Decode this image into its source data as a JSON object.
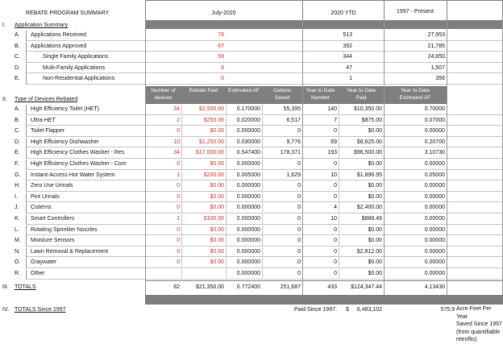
{
  "sheet": {
    "title": "REBATE PROGRAM SUMMARY",
    "col_headers": {
      "july": "July-2020",
      "ytd": "2020 YTD",
      "present": "1997 - Present"
    },
    "section1": {
      "num": "I.",
      "label": "Application Summary",
      "rows": [
        {
          "letter": "A.",
          "label": "Applications Received",
          "july": "78",
          "ytd": "513",
          "present": "27,953",
          "indent": false
        },
        {
          "letter": "B.",
          "label": "Applications Approved",
          "july": "67",
          "ytd": "392",
          "present": "21,785",
          "indent": false
        },
        {
          "letter": "C.",
          "label": "Single Family Applications",
          "july": "59",
          "ytd": "344",
          "present": "24,850",
          "indent": true
        },
        {
          "letter": "D.",
          "label": "Multi-Family Applications",
          "july": "8",
          "ytd": "47",
          "present": "1,507",
          "indent": true
        },
        {
          "letter": "E.",
          "label": "Non-Residential Applications",
          "july": "0",
          "ytd": "1",
          "present": "356",
          "indent": true
        }
      ]
    },
    "section2": {
      "num": "II.",
      "label": "Type of Devices Rebated",
      "headers": [
        {
          "line1": "Number of",
          "line2": "devices"
        },
        {
          "line1": "",
          "line2": "Rebate Paid"
        },
        {
          "line1": "",
          "line2": "Estimated AF"
        },
        {
          "line1": "Gallons",
          "line2": "Saved"
        },
        {
          "line1": "Year to Date",
          "line2": "Number"
        },
        {
          "line1": "Year to Date",
          "line2": "Paid"
        },
        {
          "line1": "Year to Date",
          "line2": "Estimated AF"
        }
      ],
      "rows": [
        {
          "letter": "A.",
          "label": "High Efficiency Toilet (HET)",
          "devices": "34",
          "paid": "$2,550.00",
          "af": "0.170000",
          "gallons": "55,395",
          "ytd_num": "140",
          "ytd_paid": "$10,350.00",
          "ytd_af": "0.70000"
        },
        {
          "letter": "B.",
          "label": "Ultra HET",
          "devices": "2",
          "paid": "$250.00",
          "af": "0.020000",
          "gallons": "6,517",
          "ytd_num": "7",
          "ytd_paid": "$875.00",
          "ytd_af": "0.07000"
        },
        {
          "letter": "C.",
          "label": "Toilet Flapper",
          "devices": "0",
          "paid": "$0.00",
          "af": "0.000000",
          "gallons": "0",
          "ytd_num": "0",
          "ytd_paid": "$0.00",
          "ytd_af": "0.00000"
        },
        {
          "letter": "D.",
          "label": "High Efficiency Dishwasher",
          "devices": "10",
          "paid": "$1,250.00",
          "af": "0.030000",
          "gallons": "9,776",
          "ytd_num": "69",
          "ytd_paid": "$8,625.00",
          "ytd_af": "0.20700"
        },
        {
          "letter": "E.",
          "label": "High Efficiency Clothes Washer - Res",
          "devices": "34",
          "paid": "$17,000.00",
          "af": "0.547400",
          "gallons": "178,371",
          "ytd_num": "193",
          "ytd_paid": "$96,500.00",
          "ytd_af": "3.10730"
        },
        {
          "letter": "F.",
          "label": "High Efficiency Clothes Washer - Com",
          "devices": "0",
          "paid": "$0.00",
          "af": "0.000000",
          "gallons": "0",
          "ytd_num": "0",
          "ytd_paid": "$0.00",
          "ytd_af": "0.00000"
        },
        {
          "letter": "G.",
          "label": "Instant-Access Hot Water System",
          "devices": "1",
          "paid": "$200.00",
          "af": "0.005000",
          "gallons": "1,629",
          "ytd_num": "10",
          "ytd_paid": "$1,896.95",
          "ytd_af": "0.05000"
        },
        {
          "letter": "H.",
          "label": "Zero Use Urinals",
          "devices": "0",
          "paid": "$0.00",
          "af": "0.000000",
          "gallons": "0",
          "ytd_num": "0",
          "ytd_paid": "$0.00",
          "ytd_af": "0.00000"
        },
        {
          "letter": "I.",
          "label": "Pint Urinals",
          "devices": "0",
          "paid": "$0.00",
          "af": "0.000000",
          "gallons": "0",
          "ytd_num": "0",
          "ytd_paid": "$0.00",
          "ytd_af": "0.00000"
        },
        {
          "letter": "J.",
          "label": "Cisterns",
          "devices": "0",
          "paid": "$0.00",
          "af": "0.000000",
          "gallons": "0",
          "ytd_num": "4",
          "ytd_paid": "$2,400.00",
          "ytd_af": "0.00000"
        },
        {
          "letter": "K.",
          "label": "Smart Controllers",
          "devices": "1",
          "paid": "$100.00",
          "af": "0.000000",
          "gallons": "0",
          "ytd_num": "10",
          "ytd_paid": "$888.49",
          "ytd_af": "0.00000"
        },
        {
          "letter": "L.",
          "label": "Rotating Sprinkler Nozzles",
          "devices": "0",
          "paid": "$0.00",
          "af": "0.000000",
          "gallons": "0",
          "ytd_num": "0",
          "ytd_paid": "$0.00",
          "ytd_af": "0.00000"
        },
        {
          "letter": "M.",
          "label": "Moisture Sensors",
          "devices": "0",
          "paid": "$0.00",
          "af": "0.000000",
          "gallons": "0",
          "ytd_num": "0",
          "ytd_paid": "$0.00",
          "ytd_af": "0.00000"
        },
        {
          "letter": "N.",
          "label": "Lawn Removal & Replacement",
          "devices": "0",
          "paid": "$0.00",
          "af": "0.000000",
          "gallons": "0",
          "ytd_num": "0",
          "ytd_paid": "$2,812.00",
          "ytd_af": "0.00000"
        },
        {
          "letter": "O.",
          "label": "Graywater",
          "devices": "0",
          "paid": "$0.00",
          "af": "0.000000",
          "gallons": "0",
          "ytd_num": "0",
          "ytd_paid": "$0.00",
          "ytd_af": "0.00000"
        },
        {
          "letter": "R.",
          "label": "Other",
          "devices": "",
          "paid": "",
          "af": "0.000000",
          "gallons": "0",
          "ytd_num": "0",
          "ytd_paid": "$0.00",
          "ytd_af": "0.00000"
        }
      ]
    },
    "section3": {
      "num": "III.",
      "label": "TOTALS",
      "devices": "82",
      "paid": "$21,350.00",
      "af": "0.772400",
      "gallons": "251,687",
      "ytd_num": "433",
      "ytd_paid": "$124,347.44",
      "ytd_af": "4.13430"
    },
    "section4": {
      "num": "IV.",
      "label": "TOTALS Since 1997",
      "paid_label": "Paid Since 1997:",
      "currency": "$",
      "paid_value": "6,483,102",
      "af_value": "575.9",
      "af_note": [
        "Acre-Feet Per Year",
        "Saved Since 1997",
        "(from quantifiable",
        "retrofits)"
      ]
    },
    "colors": {
      "red": "#e03a2e",
      "band_gray": "#7f7f7f"
    }
  }
}
